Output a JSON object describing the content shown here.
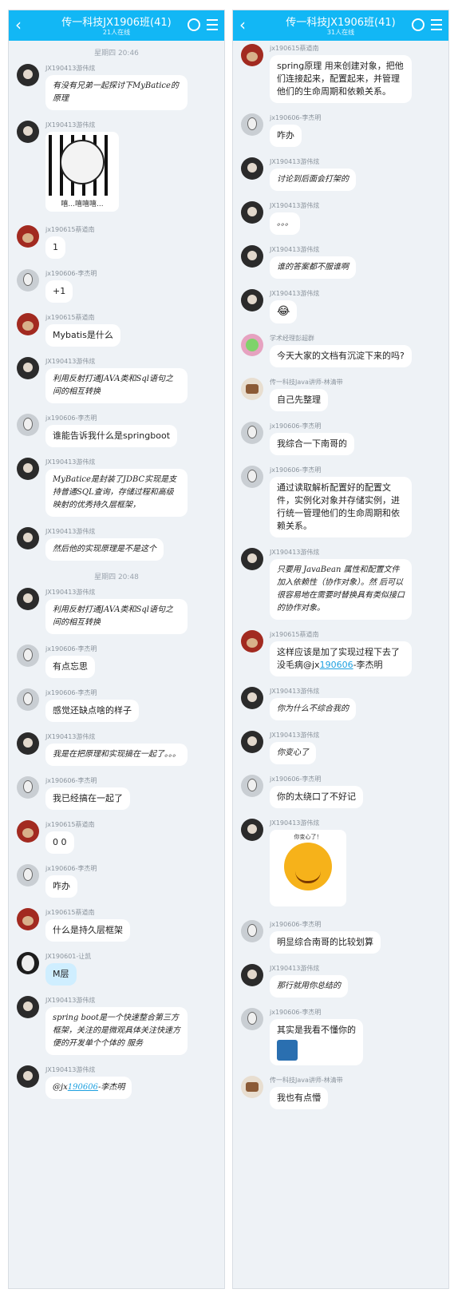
{
  "left": {
    "header": {
      "back": "‹",
      "title": "传一科技JX1906班(41)",
      "online": "21人在线"
    },
    "messages": [
      {
        "type": "time",
        "text": "星期四 20:46"
      },
      {
        "av": "dark",
        "name": "JX190413游伟炫",
        "text": "有没有兄弟一起探讨下MyBatice的原理",
        "style": "hand"
      },
      {
        "av": "dark",
        "name": "JX190413游伟炫",
        "sticker": "panda",
        "caption": "嘻...嘻嘻嘻..."
      },
      {
        "av": "red",
        "name": "jx190615蔡道南",
        "text": "1"
      },
      {
        "av": "gray",
        "name": "jx190606-李杰明",
        "text": "+1"
      },
      {
        "av": "red",
        "name": "jx190615蔡道南",
        "text": "Mybatis是什么"
      },
      {
        "av": "dark",
        "name": "JX190413游伟炫",
        "text": "利用反射打通JAVA类和Sql语句之间的相互转换",
        "style": "hand"
      },
      {
        "av": "gray",
        "name": "jx190606-李杰明",
        "text": "谁能告诉我什么是springboot"
      },
      {
        "av": "dark",
        "name": "JX190413游伟炫",
        "text": "MyBatice是封装了JDBC实现是支持普通SQL查询，存储过程和高级映射的优秀持久层框架，",
        "style": "hand"
      },
      {
        "av": "dark",
        "name": "JX190413游伟炫",
        "text": "然后他的实现原理是不是这个",
        "style": "hand"
      },
      {
        "type": "time",
        "text": "星期四 20:48"
      },
      {
        "av": "dark",
        "name": "JX190413游伟炫",
        "text": "利用反射打通JAVA类和Sql语句之间的相互转换",
        "style": "hand"
      },
      {
        "av": "gray",
        "name": "jx190606-李杰明",
        "text": "有点忘思"
      },
      {
        "av": "gray",
        "name": "jx190606-李杰明",
        "text": "感觉还缺点啥的样子"
      },
      {
        "av": "dark",
        "name": "JX190413游伟炫",
        "text": "我是在把原理和实现搞在一起了。。。",
        "style": "hand"
      },
      {
        "av": "gray",
        "name": "jx190606-李杰明",
        "text": "我已经搞在一起了"
      },
      {
        "av": "red",
        "name": "jx190615蔡道南",
        "text": "0 0"
      },
      {
        "av": "gray",
        "name": "jx190606-李杰明",
        "text": "咋办"
      },
      {
        "av": "red",
        "name": "jx190615蔡道南",
        "text": "什么是持久层框架"
      },
      {
        "av": "dark2",
        "name": "JX190601-让凯",
        "text": "M层",
        "style": "blue"
      },
      {
        "av": "dark",
        "name": "JX190413游伟炫",
        "text": "spring boot是一个快速整合第三方框架，关注的是微观具体关注快速方便的开发单个个体的 服务",
        "style": "hand"
      },
      {
        "av": "dark",
        "name": "JX190413游伟炫",
        "text_prefix": "@jx",
        "link": "190606",
        "text_suffix": "-李杰明",
        "style": "hand"
      }
    ]
  },
  "right": {
    "header": {
      "back": "‹",
      "title": "传一科技JX1906班(41)",
      "online": "31人在线"
    },
    "messages": [
      {
        "av": "red",
        "name": "jx190615蔡道南",
        "text": "spring原理 用来创建对象，把他们连接起来，配置起来，并管理他们的生命周期和依赖关系。"
      },
      {
        "av": "gray",
        "name": "jx190606-李杰明",
        "text": "咋办"
      },
      {
        "av": "dark",
        "name": "JX190413游伟炫",
        "text": "讨论到后面会打架的",
        "style": "hand"
      },
      {
        "av": "dark",
        "name": "JX190413游伟炫",
        "text": "。。。",
        "style": "hand"
      },
      {
        "av": "dark",
        "name": "JX190413游伟炫",
        "text": "谁的答案都不服谁啊",
        "style": "hand"
      },
      {
        "av": "dark",
        "name": "JX190413游伟炫",
        "text": "😂",
        "style": "emoji"
      },
      {
        "av": "pink",
        "name": "学术经理彭超群",
        "text": "今天大家的文档有沉淀下来的吗?"
      },
      {
        "av": "cup",
        "name": "传一科技Java讲师-林清带",
        "text": "自己先整理"
      },
      {
        "av": "gray",
        "name": "jx190606-李杰明",
        "text": "我综合一下南哥的"
      },
      {
        "av": "gray",
        "name": "jx190606-李杰明",
        "text": "通过读取解析配置好的配置文件，实例化对象并存储实例，进行统一管理他们的生命周期和依赖关系。"
      },
      {
        "av": "dark",
        "name": "JX190413游伟炫",
        "text": "只要用 JavaBean 属性和配置文件加入依赖性（协作对象）。然 后可以很容易地在需要时替换具有类似接口的协作对象。",
        "style": "hand"
      },
      {
        "av": "red",
        "name": "jx190615蔡道南",
        "text_prefix": "这样应该是加了实现过程下去了   没毛病@jx",
        "link": "190606",
        "text_suffix": "-李杰明"
      },
      {
        "av": "dark",
        "name": "JX190413游伟炫",
        "text": "你为什么不综合我的",
        "style": "hand"
      },
      {
        "av": "dark",
        "name": "JX190413游伟炫",
        "text": "你变心了",
        "style": "hand"
      },
      {
        "av": "gray",
        "name": "jx190606-李杰明",
        "text": "你的太绕口了不好记"
      },
      {
        "av": "dark",
        "name": "JX190413游伟炫",
        "sticker": "smiley",
        "caption": "你变心了！"
      },
      {
        "av": "gray",
        "name": "jx190606-李杰明",
        "text": "明显综合南哥的比较划算"
      },
      {
        "av": "dark",
        "name": "JX190413游伟炫",
        "text": "那行就用你总结的",
        "style": "hand"
      },
      {
        "av": "gray",
        "name": "jx190606-李杰明",
        "text": "其实是我看不懂你的",
        "thumb": true
      },
      {
        "av": "cup",
        "name": "传一科技Java讲师-林清带",
        "text": "我也有点懵"
      }
    ]
  }
}
